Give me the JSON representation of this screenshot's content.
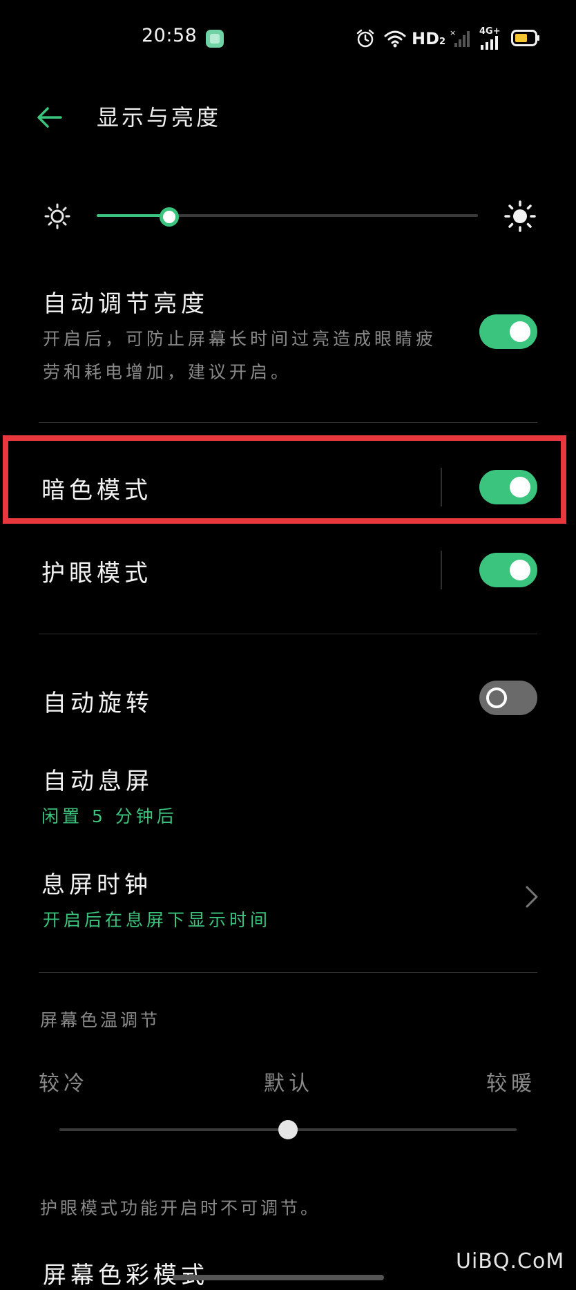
{
  "status_bar": {
    "time": "20:58",
    "network_label": "HD",
    "network_sub": "2",
    "cell_label": "4G+"
  },
  "header": {
    "title": "显示与亮度"
  },
  "brightness": {
    "level": 0.19
  },
  "auto_brightness": {
    "title": "自动调节亮度",
    "desc_line1": "开启后，可防止屏幕长时间过亮造成眼睛疲",
    "desc_line2": "劳和耗电增加，建议开启。",
    "enabled": true
  },
  "dark_mode": {
    "title": "暗色模式",
    "enabled": true
  },
  "eye_comfort": {
    "title": "护眼模式",
    "enabled": true
  },
  "auto_rotate": {
    "title": "自动旋转",
    "enabled": false
  },
  "auto_screen_off": {
    "title": "自动息屏",
    "value": "闲置 5 分钟后"
  },
  "aod_clock": {
    "title": "息屏时钟",
    "desc": "开启后在息屏下显示时间"
  },
  "color_temp": {
    "section_title": "屏幕色温调节",
    "labels": [
      "较冷",
      "默认",
      "较暖"
    ],
    "level": 0.5,
    "note": "护眼模式功能开启时不可调节。"
  },
  "color_mode": {
    "title": "屏幕色彩模式"
  },
  "watermark": "UiBQ.CoM",
  "colors": {
    "accent": "#3bc47e",
    "highlight": "#e8383d",
    "background": "#000000"
  }
}
